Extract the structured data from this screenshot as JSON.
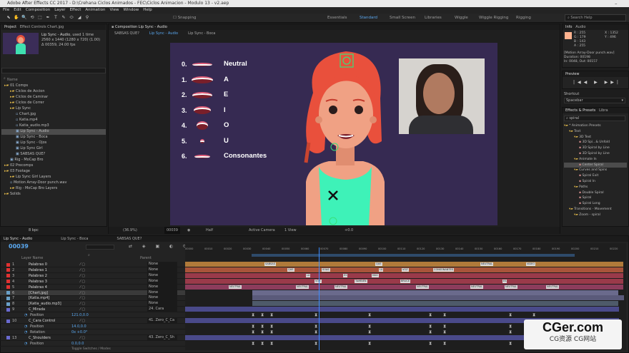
{
  "window": {
    "title": "Adobe After Effects CC 2017 - D:\\Crehana Ciclos Animados - FEC\\Ciclos Animacion - Modulo 13 - v2.aep"
  },
  "menu": [
    "File",
    "Edit",
    "Composition",
    "Layer",
    "Effect",
    "Animation",
    "View",
    "Window",
    "Help"
  ],
  "workspaces": [
    "Essentials",
    "Standard",
    "Small Screen",
    "Libraries",
    "Wiggle",
    "Wiggle Rigging",
    "Rigging"
  ],
  "snapping": "Snapping",
  "search_help": "Search Help",
  "project": {
    "tab": "Project",
    "tab2": "Effect Controls Chart.jpg",
    "preview_name": "Lip Sync - Audio",
    "preview_used": ", used 1 time",
    "preview_dims": "2560 x 1440 (1280 x 720) (1.00)",
    "preview_dur": "Δ 00359, 24.00 fps",
    "col_name": "Name",
    "items": [
      {
        "label": "01 Comps",
        "indent": 0,
        "kind": "folder"
      },
      {
        "label": "Ciclos de Accion",
        "indent": 1,
        "kind": "folder"
      },
      {
        "label": "Ciclos de Caminar",
        "indent": 1,
        "kind": "folder"
      },
      {
        "label": "Ciclos de Correr",
        "indent": 1,
        "kind": "folder"
      },
      {
        "label": "Lip Sync",
        "indent": 1,
        "kind": "folder"
      },
      {
        "label": "Chart.jpg",
        "indent": 2,
        "kind": "file"
      },
      {
        "label": "Katia.mp4",
        "indent": 2,
        "kind": "file"
      },
      {
        "label": "Katia_audio.mp3",
        "indent": 2,
        "kind": "file"
      },
      {
        "label": "Lip Sync - Audio",
        "indent": 2,
        "kind": "comp",
        "selected": true
      },
      {
        "label": "Lip Sync - Boca",
        "indent": 2,
        "kind": "comp"
      },
      {
        "label": "Lip Sync - Ojos",
        "indent": 2,
        "kind": "comp"
      },
      {
        "label": "Lip Sync Girl",
        "indent": 2,
        "kind": "comp"
      },
      {
        "label": "SABSAS QUE?",
        "indent": 2,
        "kind": "comp"
      },
      {
        "label": "Rig - MoCap Bro",
        "indent": 1,
        "kind": "comp"
      },
      {
        "label": "02 Precomps",
        "indent": 0,
        "kind": "folder"
      },
      {
        "label": "03 Footage",
        "indent": 0,
        "kind": "folder"
      },
      {
        "label": "Lip Sync Girl Layers",
        "indent": 1,
        "kind": "folder"
      },
      {
        "label": "Motion Array-Door punch.wav",
        "indent": 1,
        "kind": "file"
      },
      {
        "label": "Rig - MoCap Bro Layers",
        "indent": 1,
        "kind": "folder"
      },
      {
        "label": "Solids",
        "indent": 0,
        "kind": "folder"
      }
    ],
    "bpc": "8 bpc"
  },
  "composition": {
    "tab": "Composition Lip Sync - Audio",
    "subtabs": [
      "SABSAS QUE?",
      "Lip Sync - Audio",
      "Lip Sync - Boca"
    ],
    "mouth_rows": [
      {
        "num": "0.",
        "label": "Neutral"
      },
      {
        "num": "1.",
        "label": "A"
      },
      {
        "num": "2.",
        "label": "E"
      },
      {
        "num": "3.",
        "label": "I"
      },
      {
        "num": "4.",
        "label": "O"
      },
      {
        "num": "5.",
        "label": "U"
      },
      {
        "num": "6.",
        "label": "Consonantes"
      }
    ],
    "footer": {
      "zoom": "(36.9%)",
      "time": "00039",
      "res": "Half",
      "camera": "Active Camera",
      "view": "1 View",
      "offset": "+0.0"
    }
  },
  "info": {
    "tab": "Info",
    "tab2": "Audio",
    "r": "R : 255",
    "g": "G : 179",
    "b": "B : 143",
    "a": "A : 255",
    "x": "X : 1352",
    "y": "Y : 496",
    "file": "[Motion Array-Door punch.wav]",
    "duration": "Duration: 00198",
    "inout": "In: 0048, Out: 00157"
  },
  "preview": {
    "tab": "Preview"
  },
  "shortcut": {
    "label": "Shortcut",
    "value": "Spacebar"
  },
  "effects": {
    "tab": "Effects & Presets",
    "tab2": "Libra",
    "search": "spiral",
    "items": [
      {
        "label": "* Animation Presets",
        "indent": 0
      },
      {
        "label": "Text",
        "indent": 1
      },
      {
        "label": "3D Text",
        "indent": 2
      },
      {
        "label": "3D Spi...& Unfold",
        "indent": 3
      },
      {
        "label": "3D Spiral by Line",
        "indent": 3
      },
      {
        "label": "3D Spiral by Line",
        "indent": 3
      },
      {
        "label": "Animate In",
        "indent": 2
      },
      {
        "label": "Center Spiral",
        "indent": 3,
        "selected": true
      },
      {
        "label": "Curves and Spins",
        "indent": 2
      },
      {
        "label": "Spiral Exit",
        "indent": 3
      },
      {
        "label": "Spiral In",
        "indent": 3
      },
      {
        "label": "Paths",
        "indent": 2
      },
      {
        "label": "Double Spiral",
        "indent": 3
      },
      {
        "label": "Spiral",
        "indent": 3
      },
      {
        "label": "Spiral Long",
        "indent": 3
      },
      {
        "label": "Transitions - Movement",
        "indent": 1
      },
      {
        "label": "Zoom - spiral",
        "indent": 2
      }
    ]
  },
  "timeline": {
    "tabs": [
      "Lip Sync - Audio",
      "Lip Sync - Boca",
      "SABSAS QUE?"
    ],
    "time": "00039",
    "col_layer": "Layer Name",
    "col_parent": "Parent",
    "footer": "Toggle Switches / Modes",
    "ruler": [
      "00000",
      "00010",
      "00020",
      "00030",
      "00040",
      "00050",
      "00060",
      "00070",
      "00080",
      "00090",
      "00100",
      "00110",
      "00120",
      "00130",
      "00140",
      "00150",
      "00160",
      "00170",
      "00180",
      "00190",
      "00200",
      "00210",
      "00220"
    ],
    "layers": [
      {
        "num": "1",
        "name": "Palabras 0",
        "color": "#e03131",
        "parent": "None",
        "bar": "#b07a3a"
      },
      {
        "num": "2",
        "name": "Palabras 1",
        "color": "#e03131",
        "parent": "None",
        "bar": "#a8543a"
      },
      {
        "num": "3",
        "name": "Palabras 2",
        "color": "#e03131",
        "parent": "None",
        "bar": "#9a3a4a"
      },
      {
        "num": "4",
        "name": "Palabras 3",
        "color": "#e03131",
        "parent": "None",
        "bar": "#9a3a4a"
      },
      {
        "num": "5",
        "name": "Palabras 4",
        "color": "#e03131",
        "parent": "None",
        "bar": "#8c3c5c"
      },
      {
        "num": "6",
        "name": "[Chart.jpg]",
        "color": "#6aa0c8",
        "parent": "None",
        "bar": "#6a6a8c",
        "selected": true
      },
      {
        "num": "7",
        "name": "[Katia.mp4]",
        "color": "#6aa0c8",
        "parent": "None",
        "bar": "#5a5a7a"
      },
      {
        "num": "8",
        "name": "[Katia_audio.mp3]",
        "color": "#6aa0c8",
        "parent": "None",
        "bar": "#4e5a6a"
      },
      {
        "num": "9",
        "name": "C_Mirada",
        "color": "#6a6ad0",
        "parent": "24. Cara",
        "bar": "#4a4a8a"
      },
      {
        "num": "",
        "name": "Position",
        "color": "",
        "parent": "",
        "prop": true,
        "value": "121.0,0.0"
      },
      {
        "num": "10",
        "name": "C_Cara Control",
        "color": "#6a6ad0",
        "parent": "41. Zero_C_Ca",
        "bar": "#4a4a8a"
      },
      {
        "num": "",
        "name": "Position",
        "color": "",
        "parent": "",
        "prop": true,
        "value": "14.0,0.0"
      },
      {
        "num": "",
        "name": "Rotation",
        "color": "",
        "parent": "",
        "prop": true,
        "value": "0x +0.0°"
      },
      {
        "num": "13",
        "name": "C_Shoulders",
        "color": "#6a6ad0",
        "parent": "43. Zero_C_Sh",
        "bar": "#4a4a8a"
      },
      {
        "num": "",
        "name": "Position",
        "color": "",
        "parent": "",
        "prop": true,
        "value": "0.0,0.0"
      }
    ],
    "markers": [
      {
        "row": 0,
        "items": [
          "SABSAS",
          "QUE",
          "NEUTRAL",
          "VIDEO"
        ]
      },
      {
        "row": 1,
        "items": [
          "QUE",
          "SOAS",
          "LA",
          "VOZ",
          "CONSONANTES"
        ]
      },
      {
        "row": 2,
        "items": [
          "LA",
          "ES",
          "MAS"
        ]
      },
      {
        "row": 3,
        "items": [
          "VOZ",
          "TAMBIEN",
          "BRUCE",
          "ES"
        ]
      },
      {
        "row": 4,
        "items": [
          "NEUTRAL",
          "NEUTRAL",
          "NEUTRAL",
          "NEUTRAL",
          "NEUTRAL",
          "NEUTRAL",
          "NEUTRAL"
        ]
      }
    ]
  },
  "watermark": {
    "title": "CGer.com",
    "sub": "CG资源 CG网站"
  }
}
